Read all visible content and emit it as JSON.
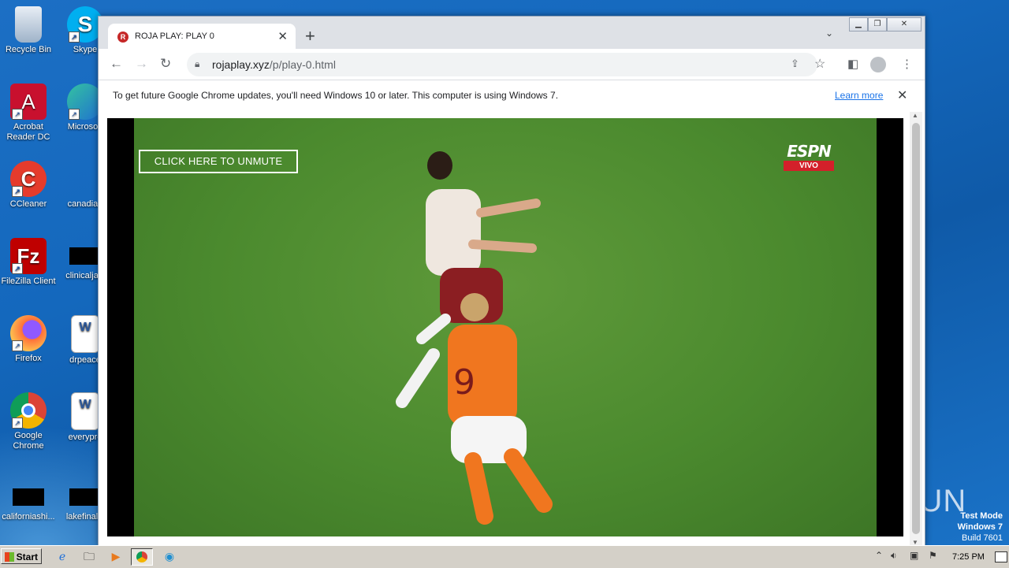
{
  "desktop": {
    "icons": [
      {
        "label": "Recycle Bin"
      },
      {
        "label": "Skype"
      },
      {
        "label": "Acrobat Reader DC"
      },
      {
        "label": "Microsoft"
      },
      {
        "label": "CCleaner"
      },
      {
        "label": "canadian"
      },
      {
        "label": "FileZilla Client"
      },
      {
        "label": "clinicaljacl"
      },
      {
        "label": "Firefox"
      },
      {
        "label": "drpeace"
      },
      {
        "label": "Google Chrome"
      },
      {
        "label": "everypre"
      },
      {
        "label": "californiashi..."
      },
      {
        "label": "lakefinally"
      }
    ],
    "watermark": {
      "line1": "Test Mode",
      "line2": "Windows 7",
      "line3": "Build 7601"
    },
    "anyrun": "ANY RUN"
  },
  "browser": {
    "tab_title": "ROJA PLAY: PLAY 0",
    "url_host": "rojaplay.xyz",
    "url_path": "/p/play-0.html",
    "infobar": {
      "message": "To get future Google Chrome updates, you'll need Windows 10 or later. This computer is using Windows 7.",
      "link": "Learn more"
    },
    "player": {
      "unmute_label": "CLICK HERE TO UNMUTE",
      "brand": "ESPN",
      "live_badge": "VIVO"
    }
  },
  "taskbar": {
    "start_label": "Start",
    "time": "7:25 PM"
  }
}
